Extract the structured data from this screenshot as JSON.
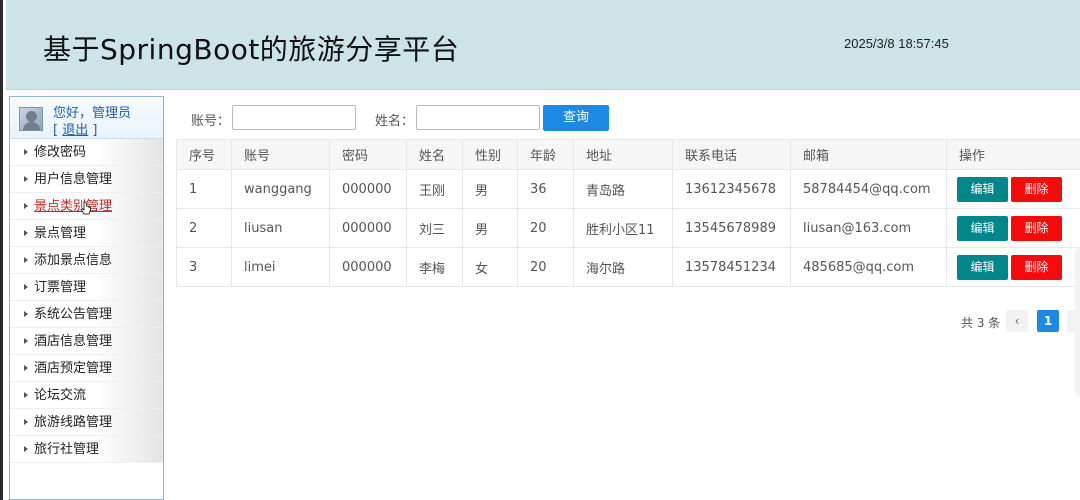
{
  "header": {
    "title": "基于SpringBoot的旅游分享平台",
    "clock": "2025/3/8 18:57:45"
  },
  "sidebar": {
    "greeting": "您好，管理员",
    "logout_prefix": "[",
    "logout_label": "退出",
    "logout_suffix": "]",
    "items": [
      {
        "label": "修改密码"
      },
      {
        "label": "用户信息管理"
      },
      {
        "label": "景点类别管理"
      },
      {
        "label": "景点管理"
      },
      {
        "label": "添加景点信息"
      },
      {
        "label": "订票管理"
      },
      {
        "label": "系统公告管理"
      },
      {
        "label": "酒店信息管理"
      },
      {
        "label": "酒店预定管理"
      },
      {
        "label": "论坛交流"
      },
      {
        "label": "旅游线路管理"
      },
      {
        "label": "旅行社管理"
      }
    ]
  },
  "search": {
    "account_label": "账号：",
    "account_value": "",
    "name_label": "姓名：",
    "name_value": "",
    "query_button": "查询"
  },
  "table": {
    "headers": [
      "序号",
      "账号",
      "密码",
      "姓名",
      "性别",
      "年龄",
      "地址",
      "联系电话",
      "邮箱",
      "操作"
    ],
    "rows": [
      [
        "1",
        "wanggang",
        "000000",
        "王刚",
        "男",
        "36",
        "青岛路",
        "13612345678",
        "58784454@qq.com"
      ],
      [
        "2",
        "liusan",
        "000000",
        "刘三",
        "男",
        "20",
        "胜利小区11",
        "13545678989",
        "liusan@163.com"
      ],
      [
        "3",
        "limei",
        "000000",
        "李梅",
        "女",
        "20",
        "海尔路",
        "13578451234",
        "485685@qq.com"
      ]
    ],
    "edit_label": "编辑",
    "delete_label": "删除"
  },
  "pagination": {
    "total": "共 3 条",
    "current_page": "1",
    "prev_icon": "‹"
  },
  "colors": {
    "header_bg": "#cce4e8",
    "accent": "#1e88e5",
    "edit": "#00868b",
    "delete": "#f40c0c"
  }
}
